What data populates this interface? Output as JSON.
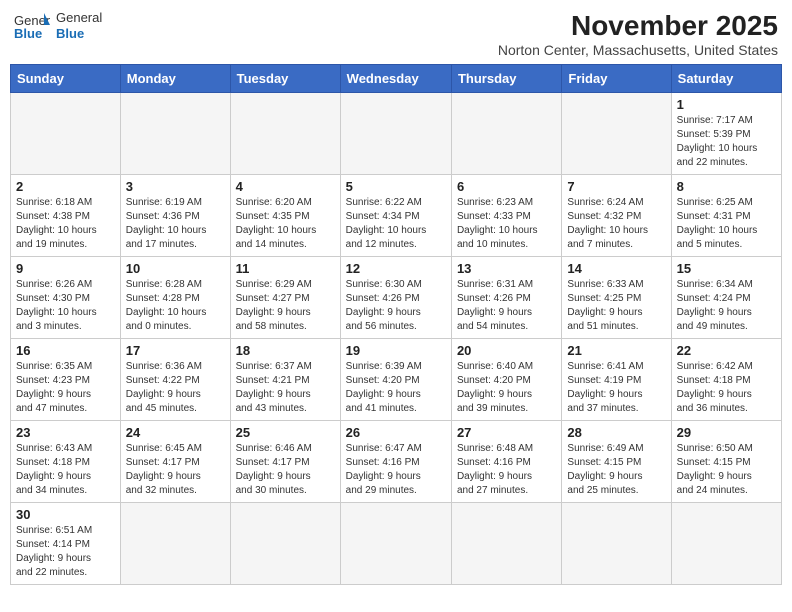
{
  "header": {
    "logo_general": "General",
    "logo_blue": "Blue",
    "month": "November 2025",
    "location": "Norton Center, Massachusetts, United States"
  },
  "weekdays": [
    "Sunday",
    "Monday",
    "Tuesday",
    "Wednesday",
    "Thursday",
    "Friday",
    "Saturday"
  ],
  "weeks": [
    [
      {
        "day": "",
        "info": ""
      },
      {
        "day": "",
        "info": ""
      },
      {
        "day": "",
        "info": ""
      },
      {
        "day": "",
        "info": ""
      },
      {
        "day": "",
        "info": ""
      },
      {
        "day": "",
        "info": ""
      },
      {
        "day": "1",
        "info": "Sunrise: 7:17 AM\nSunset: 5:39 PM\nDaylight: 10 hours\nand 22 minutes."
      }
    ],
    [
      {
        "day": "2",
        "info": "Sunrise: 6:18 AM\nSunset: 4:38 PM\nDaylight: 10 hours\nand 19 minutes."
      },
      {
        "day": "3",
        "info": "Sunrise: 6:19 AM\nSunset: 4:36 PM\nDaylight: 10 hours\nand 17 minutes."
      },
      {
        "day": "4",
        "info": "Sunrise: 6:20 AM\nSunset: 4:35 PM\nDaylight: 10 hours\nand 14 minutes."
      },
      {
        "day": "5",
        "info": "Sunrise: 6:22 AM\nSunset: 4:34 PM\nDaylight: 10 hours\nand 12 minutes."
      },
      {
        "day": "6",
        "info": "Sunrise: 6:23 AM\nSunset: 4:33 PM\nDaylight: 10 hours\nand 10 minutes."
      },
      {
        "day": "7",
        "info": "Sunrise: 6:24 AM\nSunset: 4:32 PM\nDaylight: 10 hours\nand 7 minutes."
      },
      {
        "day": "8",
        "info": "Sunrise: 6:25 AM\nSunset: 4:31 PM\nDaylight: 10 hours\nand 5 minutes."
      }
    ],
    [
      {
        "day": "9",
        "info": "Sunrise: 6:26 AM\nSunset: 4:30 PM\nDaylight: 10 hours\nand 3 minutes."
      },
      {
        "day": "10",
        "info": "Sunrise: 6:28 AM\nSunset: 4:28 PM\nDaylight: 10 hours\nand 0 minutes."
      },
      {
        "day": "11",
        "info": "Sunrise: 6:29 AM\nSunset: 4:27 PM\nDaylight: 9 hours\nand 58 minutes."
      },
      {
        "day": "12",
        "info": "Sunrise: 6:30 AM\nSunset: 4:26 PM\nDaylight: 9 hours\nand 56 minutes."
      },
      {
        "day": "13",
        "info": "Sunrise: 6:31 AM\nSunset: 4:26 PM\nDaylight: 9 hours\nand 54 minutes."
      },
      {
        "day": "14",
        "info": "Sunrise: 6:33 AM\nSunset: 4:25 PM\nDaylight: 9 hours\nand 51 minutes."
      },
      {
        "day": "15",
        "info": "Sunrise: 6:34 AM\nSunset: 4:24 PM\nDaylight: 9 hours\nand 49 minutes."
      }
    ],
    [
      {
        "day": "16",
        "info": "Sunrise: 6:35 AM\nSunset: 4:23 PM\nDaylight: 9 hours\nand 47 minutes."
      },
      {
        "day": "17",
        "info": "Sunrise: 6:36 AM\nSunset: 4:22 PM\nDaylight: 9 hours\nand 45 minutes."
      },
      {
        "day": "18",
        "info": "Sunrise: 6:37 AM\nSunset: 4:21 PM\nDaylight: 9 hours\nand 43 minutes."
      },
      {
        "day": "19",
        "info": "Sunrise: 6:39 AM\nSunset: 4:20 PM\nDaylight: 9 hours\nand 41 minutes."
      },
      {
        "day": "20",
        "info": "Sunrise: 6:40 AM\nSunset: 4:20 PM\nDaylight: 9 hours\nand 39 minutes."
      },
      {
        "day": "21",
        "info": "Sunrise: 6:41 AM\nSunset: 4:19 PM\nDaylight: 9 hours\nand 37 minutes."
      },
      {
        "day": "22",
        "info": "Sunrise: 6:42 AM\nSunset: 4:18 PM\nDaylight: 9 hours\nand 36 minutes."
      }
    ],
    [
      {
        "day": "23",
        "info": "Sunrise: 6:43 AM\nSunset: 4:18 PM\nDaylight: 9 hours\nand 34 minutes."
      },
      {
        "day": "24",
        "info": "Sunrise: 6:45 AM\nSunset: 4:17 PM\nDaylight: 9 hours\nand 32 minutes."
      },
      {
        "day": "25",
        "info": "Sunrise: 6:46 AM\nSunset: 4:17 PM\nDaylight: 9 hours\nand 30 minutes."
      },
      {
        "day": "26",
        "info": "Sunrise: 6:47 AM\nSunset: 4:16 PM\nDaylight: 9 hours\nand 29 minutes."
      },
      {
        "day": "27",
        "info": "Sunrise: 6:48 AM\nSunset: 4:16 PM\nDaylight: 9 hours\nand 27 minutes."
      },
      {
        "day": "28",
        "info": "Sunrise: 6:49 AM\nSunset: 4:15 PM\nDaylight: 9 hours\nand 25 minutes."
      },
      {
        "day": "29",
        "info": "Sunrise: 6:50 AM\nSunset: 4:15 PM\nDaylight: 9 hours\nand 24 minutes."
      }
    ],
    [
      {
        "day": "30",
        "info": "Sunrise: 6:51 AM\nSunset: 4:14 PM\nDaylight: 9 hours\nand 22 minutes."
      },
      {
        "day": "",
        "info": ""
      },
      {
        "day": "",
        "info": ""
      },
      {
        "day": "",
        "info": ""
      },
      {
        "day": "",
        "info": ""
      },
      {
        "day": "",
        "info": ""
      },
      {
        "day": "",
        "info": ""
      }
    ]
  ]
}
